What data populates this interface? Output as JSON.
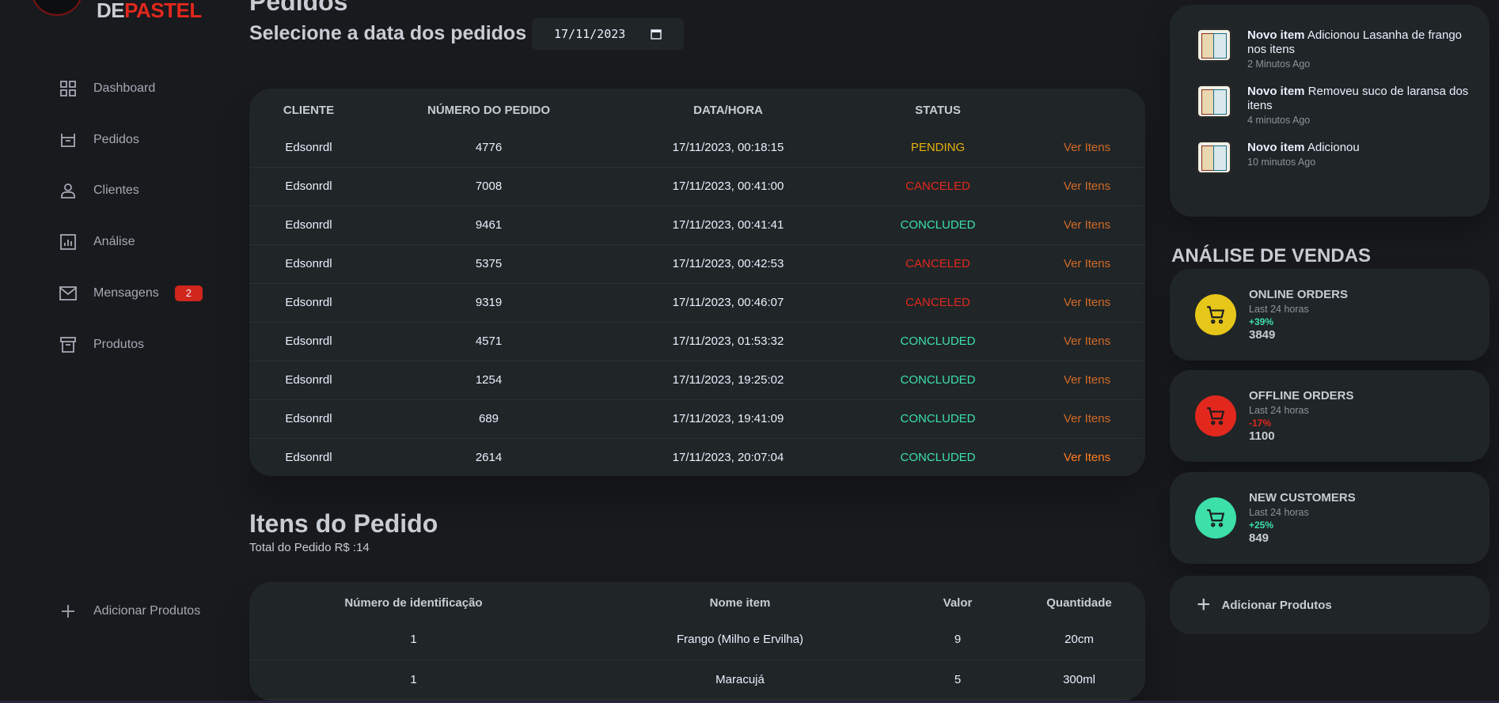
{
  "brand": {
    "part1": "DE",
    "part2": "PASTEL"
  },
  "sidebar": {
    "items": [
      {
        "label": "Dashboard",
        "icon": "grid-icon"
      },
      {
        "label": "Pedidos",
        "icon": "basket-icon"
      },
      {
        "label": "Clientes",
        "icon": "person-icon"
      },
      {
        "label": "Análise",
        "icon": "chart-icon"
      },
      {
        "label": "Mensagens",
        "icon": "mail-icon",
        "badge": "2"
      },
      {
        "label": "Produtos",
        "icon": "archive-icon"
      }
    ],
    "add_label": "Adicionar Produtos"
  },
  "main": {
    "title": "Pedidos",
    "date_label": "Selecione a data dos pedidos",
    "date_value": "17/11/2023",
    "orders": {
      "headers": [
        "CLIENTE",
        "NÚMERO DO PEDIDO",
        "DATA/HORA",
        "STATUS",
        ""
      ],
      "action_label": "Ver Itens",
      "rows": [
        {
          "cliente": "Edsonrdl",
          "numero": "4776",
          "data": "17/11/2023, 00:18:15",
          "status": "PENDING"
        },
        {
          "cliente": "Edsonrdl",
          "numero": "7008",
          "data": "17/11/2023, 00:41:00",
          "status": "CANCELED"
        },
        {
          "cliente": "Edsonrdl",
          "numero": "9461",
          "data": "17/11/2023, 00:41:41",
          "status": "CONCLUDED"
        },
        {
          "cliente": "Edsonrdl",
          "numero": "5375",
          "data": "17/11/2023, 00:42:53",
          "status": "CANCELED"
        },
        {
          "cliente": "Edsonrdl",
          "numero": "9319",
          "data": "17/11/2023, 00:46:07",
          "status": "CANCELED"
        },
        {
          "cliente": "Edsonrdl",
          "numero": "4571",
          "data": "17/11/2023, 01:53:32",
          "status": "CONCLUDED"
        },
        {
          "cliente": "Edsonrdl",
          "numero": "1254",
          "data": "17/11/2023, 19:25:02",
          "status": "CONCLUDED"
        },
        {
          "cliente": "Edsonrdl",
          "numero": "689",
          "data": "17/11/2023, 19:41:09",
          "status": "CONCLUDED"
        },
        {
          "cliente": "Edsonrdl",
          "numero": "2614",
          "data": "17/11/2023, 20:07:04",
          "status": "CONCLUDED"
        }
      ]
    },
    "items": {
      "title": "Itens do Pedido",
      "total": "Total do Pedido R$ :14",
      "headers": [
        "Número de identificação",
        "Nome item",
        "Valor",
        "Quantidade"
      ],
      "rows": [
        {
          "id": "1",
          "nome": "Frango (Milho e Ervilha)",
          "valor": "9",
          "quantidade": "20cm"
        },
        {
          "id": "1",
          "nome": "Maracujá",
          "valor": "5",
          "quantidade": "300ml"
        }
      ]
    }
  },
  "right": {
    "updates": [
      {
        "strong": "Novo item",
        "text": " Adicionou Lasanha de frango nos itens",
        "time": "2 Minutos Ago"
      },
      {
        "strong": "Novo item",
        "text": " Removeu suco de laransa dos itens",
        "time": "4 minutos Ago"
      },
      {
        "strong": "Novo item",
        "text": " Adicionou",
        "time": "10 minutos Ago"
      }
    ],
    "analysis_title": "ANÁLISE DE VENDAS",
    "stats": [
      {
        "name": "ONLINE ORDERS",
        "sub": "Last 24 horas",
        "pct": "+39%",
        "value": "3849",
        "color": "#e6c619",
        "pct_color": "#3ce0a8"
      },
      {
        "name": "OFFLINE ORDERS",
        "sub": "Last 24 horas",
        "pct": "-17%",
        "value": "1100",
        "color": "#e2281d",
        "pct_color": "#e2281d"
      },
      {
        "name": "NEW CUSTOMERS",
        "sub": "Last 24 horas",
        "pct": "+25%",
        "value": "849",
        "color": "#3ce0a8",
        "pct_color": "#3ce0a8"
      }
    ],
    "add_label": "Adicionar Produtos"
  }
}
